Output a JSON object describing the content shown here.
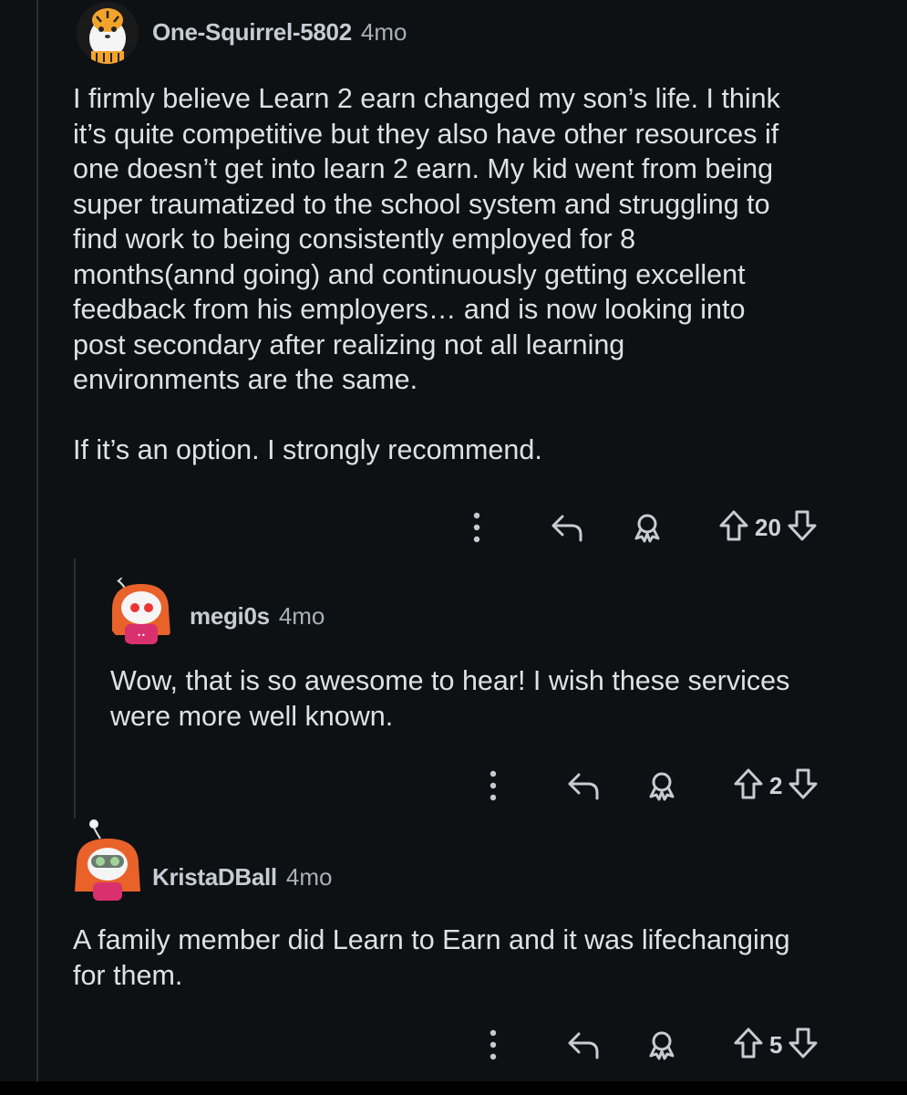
{
  "comments": [
    {
      "username": "One-Squirrel-5802",
      "age": "4mo",
      "body": "I firmly believe Learn 2 earn changed my son’s life. I think\nit’s quite competitive but they also have other resources if\none doesn’t get into learn 2 earn. My kid went from being\nsuper traumatized to the school system and struggling to\nfind work to being consistently employed for 8\nmonths(annd going) and continuously getting excellent\nfeedback from his employers… and is now looking into\npost secondary after realizing not all learning\nenvironments are the same.\n\nIf it’s an option. I strongly recommend.",
      "score": "20",
      "avatar_icon": "tiger-avatar-icon"
    },
    {
      "username": "megi0s",
      "age": "4mo",
      "body": "Wow, that is so awesome to hear! I wish these services\nwere more well known.",
      "score": "2",
      "avatar_icon": "redhead-avatar-icon"
    },
    {
      "username": "KristaDBall",
      "age": "4mo",
      "body": "A family member did Learn to Earn and it was lifechanging\nfor them.",
      "score": "5",
      "avatar_icon": "goggles-avatar-icon"
    }
  ],
  "colors": {
    "background": "#0e1114",
    "text": "#dfe2e4",
    "muted": "#a8b0b6",
    "thread_line": "#2a2f33"
  }
}
